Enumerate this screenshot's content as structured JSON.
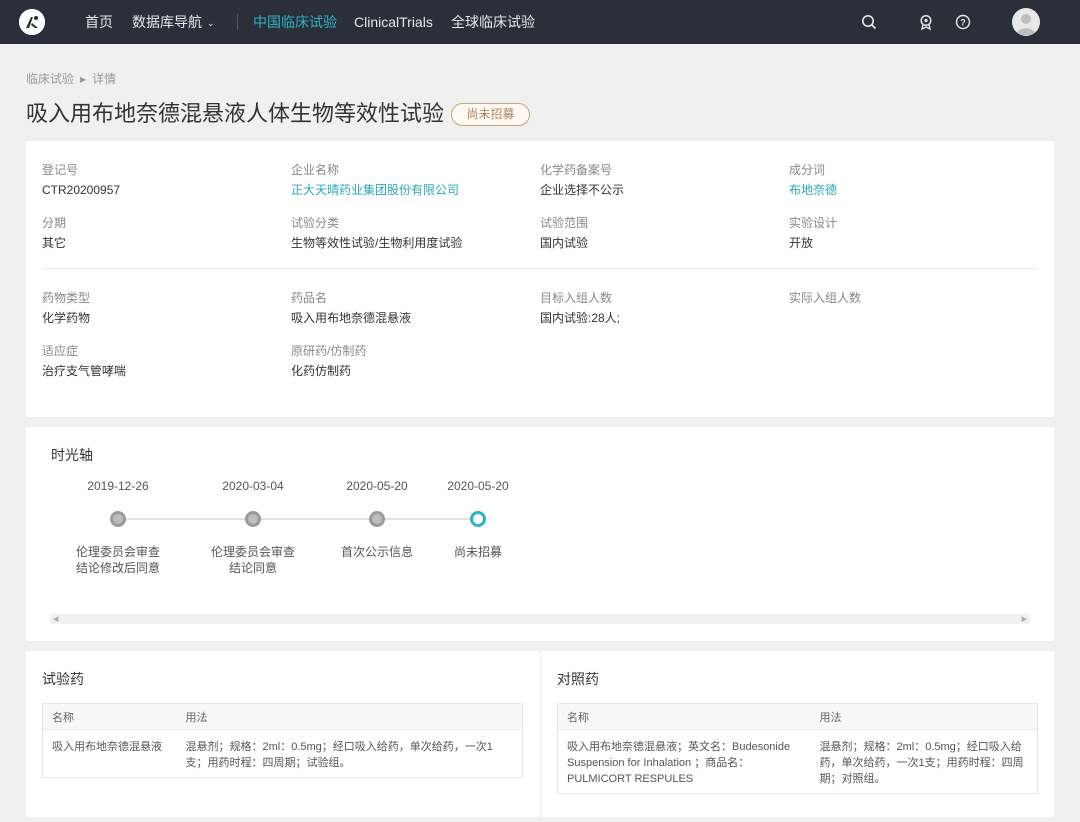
{
  "nav": {
    "items": [
      {
        "label": "首页",
        "active": false
      },
      {
        "label": "数据库导航",
        "active": false
      },
      {
        "label": "中国临床试验",
        "active": true
      },
      {
        "label": "ClinicalTrials",
        "active": false
      },
      {
        "label": "全球临床试验",
        "active": false
      }
    ],
    "accent_color": "#2fb3c6",
    "icons": [
      "search-icon",
      "award-icon",
      "help-icon",
      "user-avatar"
    ]
  },
  "breadcrumb": {
    "items": [
      "临床试验",
      "详情"
    ]
  },
  "page": {
    "title": "吸入用布地奈德混悬液人体生物等效性试验",
    "status": "尚未招募"
  },
  "info": {
    "row1": [
      {
        "label": "登记号",
        "value": "CTR20200957",
        "link": false
      },
      {
        "label": "企业名称",
        "value": "正大天晴药业集团股份有限公司",
        "link": true
      },
      {
        "label": "化学药备案号",
        "value": "企业选择不公示",
        "link": false
      },
      {
        "label": "成分词",
        "value": "布地奈德",
        "link": true
      }
    ],
    "row2": [
      {
        "label": "分期",
        "value": "其它"
      },
      {
        "label": "试验分类",
        "value": "生物等效性试验/生物利用度试验"
      },
      {
        "label": "试验范围",
        "value": "国内试验"
      },
      {
        "label": "实验设计",
        "value": "开放"
      }
    ],
    "row3": [
      {
        "label": "药物类型",
        "value": "化学药物"
      },
      {
        "label": "药品名",
        "value": "吸入用布地奈德混悬液"
      },
      {
        "label": "目标入组人数",
        "value": "国内试验:28人;"
      },
      {
        "label": "实际入组人数",
        "value": ""
      }
    ],
    "row4": [
      {
        "label": "适应症",
        "value": "治疗支气管哮喘"
      },
      {
        "label": "原研药/仿制药",
        "value": "化药仿制药"
      }
    ]
  },
  "timeline": {
    "title": "时光轴",
    "events": [
      {
        "date": "2019-12-26",
        "desc_line1": "伦理委员会审查",
        "desc_line2": "结论修改后同意",
        "current": false
      },
      {
        "date": "2020-03-04",
        "desc_line1": "伦理委员会审查",
        "desc_line2": "结论同意",
        "current": false
      },
      {
        "date": "2020-05-20",
        "desc_line1": "首次公示信息",
        "desc_line2": "",
        "current": false
      },
      {
        "date": "2020-05-20",
        "desc_line1": "尚未招募",
        "desc_line2": "",
        "current": true
      }
    ]
  },
  "test_drug": {
    "title": "试验药",
    "headers": [
      "名称",
      "用法"
    ],
    "rows": [
      {
        "name": "吸入用布地奈德混悬液",
        "usage": "混悬剂；规格：2ml：0.5mg；经口吸入给药，单次给药，一次1支；用药时程：四周期；试验组。"
      }
    ]
  },
  "control_drug": {
    "title": "对照药",
    "headers": [
      "名称",
      "用法"
    ],
    "rows": [
      {
        "name": "吸入用布地奈德混悬液；英文名：Budesonide Suspension for Inhalation ；商品名：PULMICORT RESPULES",
        "usage": "混悬剂；规格：2ml：0.5mg；经口吸入给药，单次给药，一次1支；用药时程：四周期；对照组。"
      }
    ]
  }
}
